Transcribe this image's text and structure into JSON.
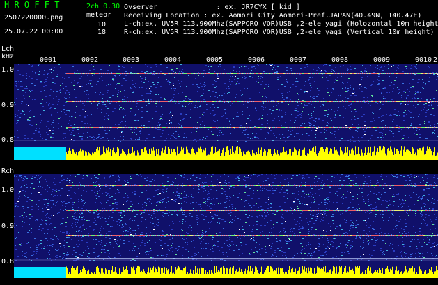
{
  "header": {
    "logo": "H R O F F T",
    "version": "2ch 0.30",
    "filename": "2507220000.png",
    "datetime": "25.07.22 00:00",
    "meteor_label": "meteor",
    "meteor_l": "10",
    "meteor_r": "18",
    "observer": "Ovserver              : ex. JR7CYX [ kid ]",
    "location": "Receiving Location : ex. Aomori City Aomori-Pref.JAPAN(40.49N, 140.47E)",
    "lch_info": "L-ch:ex. UV5R 113.900Mhz(SAPPORO VOR)USB ,2-ele yagi (Holozontal 10m height)",
    "rch_info": "R-ch:ex. UV5R 113.900Mhz(SAPPORO VOR)USB ,2-ele yagi (Vertical 10m height)"
  },
  "lch": {
    "title": "Lch",
    "unit": "kHz",
    "ticks": [
      "1.0",
      "0.9",
      "0.8"
    ]
  },
  "rch": {
    "title": "Rch",
    "ticks": [
      "1.0",
      "0.9",
      "0.8"
    ]
  },
  "minute_marks": [
    "0001",
    "0002",
    "0003",
    "0004",
    "0005",
    "0006",
    "0007",
    "0008",
    "0009",
    "0010",
    "2"
  ],
  "colors": {
    "bg_noise": "#10106a",
    "signal_yellow": "#ffff00",
    "cyan": "#00e0ff",
    "logo_green": "#00ff00"
  }
}
